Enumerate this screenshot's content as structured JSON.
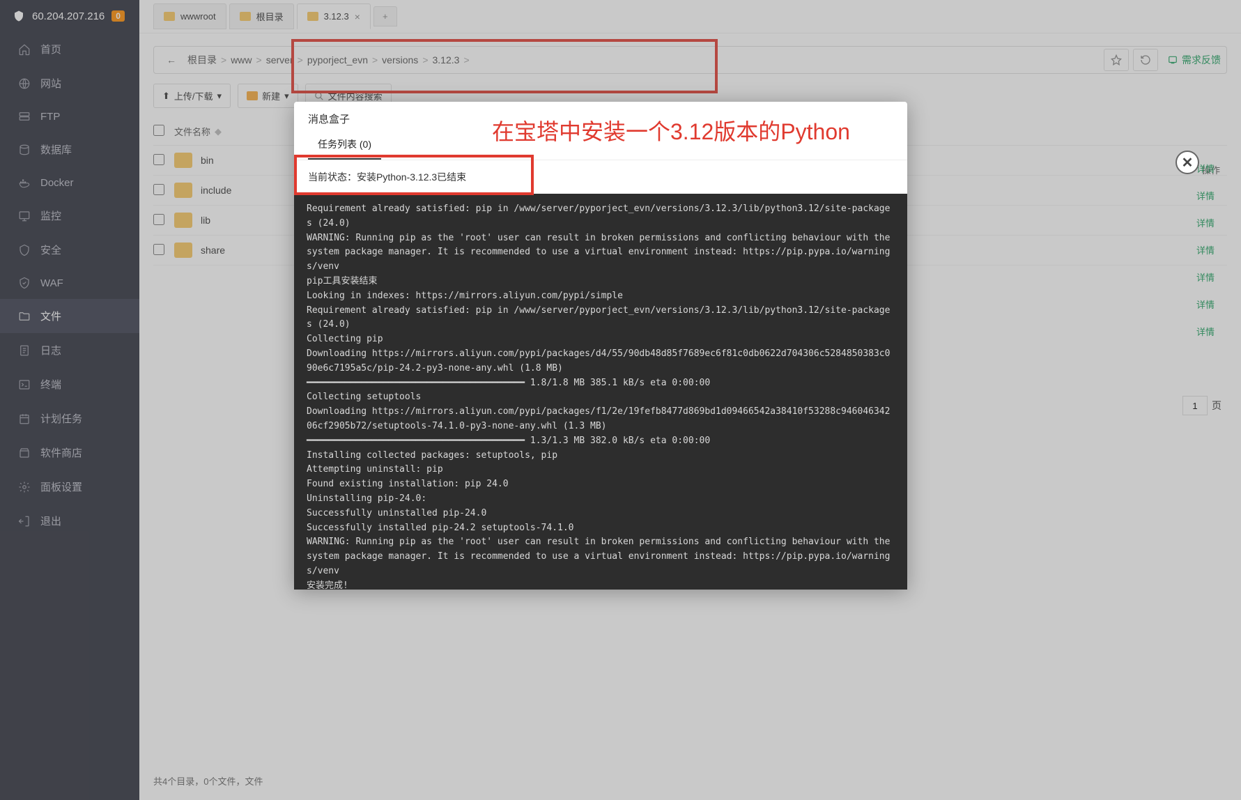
{
  "header": {
    "ip": "60.204.207.216",
    "badge": "0"
  },
  "sidebar": {
    "items": [
      {
        "label": "首页",
        "icon": "home-icon"
      },
      {
        "label": "网站",
        "icon": "globe-icon"
      },
      {
        "label": "FTP",
        "icon": "ftp-icon"
      },
      {
        "label": "数据库",
        "icon": "database-icon"
      },
      {
        "label": "Docker",
        "icon": "docker-icon"
      },
      {
        "label": "监控",
        "icon": "monitor-icon"
      },
      {
        "label": "安全",
        "icon": "shield-icon"
      },
      {
        "label": "WAF",
        "icon": "waf-icon"
      },
      {
        "label": "文件",
        "icon": "folder-icon",
        "active": true
      },
      {
        "label": "日志",
        "icon": "log-icon"
      },
      {
        "label": "终端",
        "icon": "terminal-icon"
      },
      {
        "label": "计划任务",
        "icon": "calendar-icon"
      },
      {
        "label": "软件商店",
        "icon": "store-icon"
      },
      {
        "label": "面板设置",
        "icon": "settings-icon"
      },
      {
        "label": "退出",
        "icon": "logout-icon"
      }
    ]
  },
  "tabs": [
    {
      "label": "wwwroot"
    },
    {
      "label": "根目录"
    },
    {
      "label": "3.12.3",
      "active": true,
      "closable": true
    }
  ],
  "breadcrumb": [
    "根目录",
    "www",
    "server",
    "pyporject_evn",
    "versions",
    "3.12.3"
  ],
  "feedback": "需求反馈",
  "toolbar": {
    "upload": "上传/下载",
    "newbtn": "新建",
    "search_placeholder": "文件内容搜索"
  },
  "table": {
    "header_name": "文件名称",
    "col_ops": "操作",
    "rows": [
      "bin",
      "include",
      "lib",
      "share"
    ]
  },
  "footer": "共4个目录，0个文件，文件",
  "annotation": "在宝塔中安装一个3.12版本的Python",
  "modal": {
    "title": "消息盒子",
    "tab": "任务列表 (0)",
    "status": "当前状态：安装Python-3.12.3已结束",
    "terminal": "Requirement already satisfied: pip in /www/server/pyporject_evn/versions/3.12.3/lib/python3.12/site-packages (24.0)\nWARNING: Running pip as the 'root' user can result in broken permissions and conflicting behaviour with the system package manager. It is recommended to use a virtual environment instead: https://pip.pypa.io/warnings/venv\npip工具安装结束\nLooking in indexes: https://mirrors.aliyun.com/pypi/simple\nRequirement already satisfied: pip in /www/server/pyporject_evn/versions/3.12.3/lib/python3.12/site-packages (24.0)\nCollecting pip\nDownloading https://mirrors.aliyun.com/pypi/packages/d4/55/90db48d85f7689ec6f81c0db0622d704306c5284850383c090e6c7195a5c/pip-24.2-py3-none-any.whl (1.8 MB)\n━━━━━━━━━━━━━━━━━━━━━━━━━━━━━━━━━━━━━━━━ 1.8/1.8 MB 385.1 kB/s eta 0:00:00\nCollecting setuptools\nDownloading https://mirrors.aliyun.com/pypi/packages/f1/2e/19fefb8477d869bd1d09466542a38410f53288c94604634206cf2905b72/setuptools-74.1.0-py3-none-any.whl (1.3 MB)\n━━━━━━━━━━━━━━━━━━━━━━━━━━━━━━━━━━━━━━━━ 1.3/1.3 MB 382.0 kB/s eta 0:00:00\nInstalling collected packages: setuptools, pip\nAttempting uninstall: pip\nFound existing installation: pip 24.0\nUninstalling pip-24.0:\nSuccessfully uninstalled pip-24.0\nSuccessfully installed pip-24.2 setuptools-74.1.0\nWARNING: Running pip as the 'root' user can result in broken permissions and conflicting behaviour with the system package manager. It is recommended to use a virtual environment instead: https://pip.pypa.io/warnings/venv\n安装完成!"
  },
  "actions": {
    "detail": "详情",
    "page_label": "页",
    "page_value": "1"
  }
}
